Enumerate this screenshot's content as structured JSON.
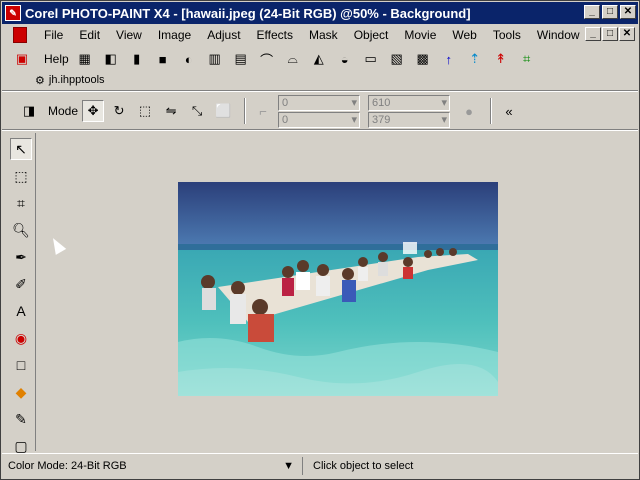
{
  "window": {
    "title": "Corel PHOTO-PAINT X4 - [hawaii.jpeg (24-Bit RGB) @50% - Background]",
    "minimize": "_",
    "maximize": "□",
    "close": "✕"
  },
  "menu": [
    "File",
    "Edit",
    "View",
    "Image",
    "Adjust",
    "Effects",
    "Mask",
    "Object",
    "Movie",
    "Web",
    "Tools",
    "Window"
  ],
  "toolbar": {
    "help_label": "Help"
  },
  "workspace": {
    "label": "jh.ihpptools"
  },
  "propertybar": {
    "mode_label": "Mode",
    "x": "0",
    "y": "0",
    "w": "610",
    "h": "379"
  },
  "canvas": {
    "image_name": "hawaii.jpeg"
  },
  "status": {
    "color_mode": "Color Mode: 24-Bit RGB",
    "hint": "Click object to select"
  }
}
